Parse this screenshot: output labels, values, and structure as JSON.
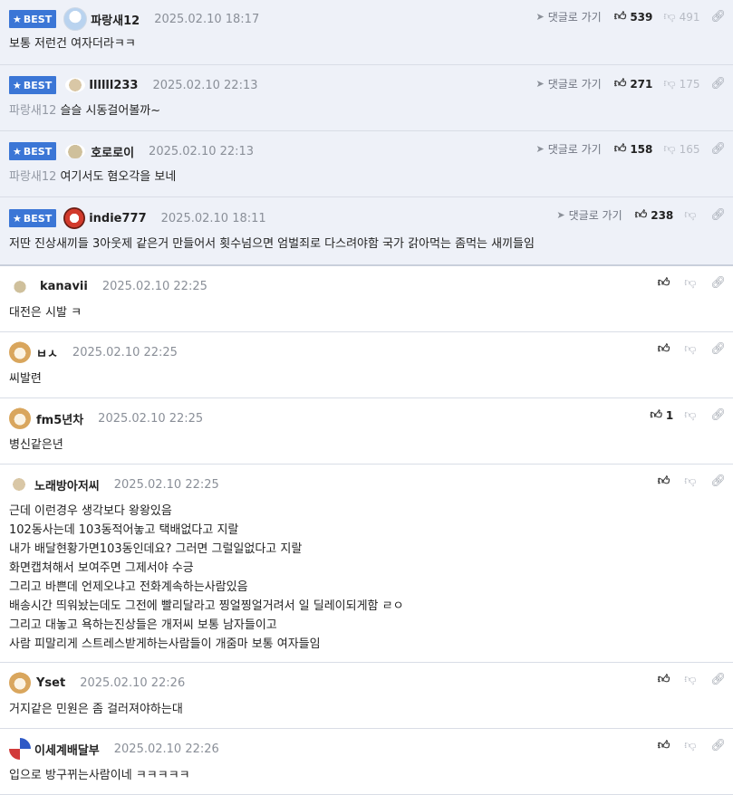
{
  "labels": {
    "best": "BEST",
    "reply_link": "댓글로 가기",
    "up_icon": "thumb-up-icon",
    "down_icon": "thumb-down-icon",
    "link_icon": "link-icon"
  },
  "best_comments": [
    {
      "nick": "파랑새12",
      "date": "2025.02.10 18:17",
      "up": "539",
      "down": "491",
      "quote": "",
      "text": "보통 저런건 여자더라ㅋㅋ"
    },
    {
      "nick": "Illlll233",
      "date": "2025.02.10 22:13",
      "up": "271",
      "down": "175",
      "quote": "파랑새12",
      "text": "슬슬 시동걸어볼까~"
    },
    {
      "nick": "호로로이",
      "date": "2025.02.10 22:13",
      "up": "158",
      "down": "165",
      "quote": "파랑새12",
      "text": "여기서도 혐오각을 보네"
    },
    {
      "nick": "indie777",
      "date": "2025.02.10 18:11",
      "up": "238",
      "down": "",
      "quote": "",
      "text": "저딴 진상새끼들 3아웃제 같은거 만들어서 횟수넘으면 엄벌죄로 다스려야함 국가 갉아먹는 좀먹는 새끼들임"
    }
  ],
  "comments": [
    {
      "nick": "kanavii",
      "date": "2025.02.10 22:25",
      "up": "",
      "lines": [
        "대전은 시발 ㅋ"
      ]
    },
    {
      "nick": "ㅂㅅ",
      "date": "2025.02.10 22:25",
      "up": "",
      "lines": [
        "씨발련"
      ]
    },
    {
      "nick": "fm5년차",
      "date": "2025.02.10 22:25",
      "up": "1",
      "lines": [
        "병신같은년"
      ]
    },
    {
      "nick": "노래방아저씨",
      "date": "2025.02.10 22:25",
      "up": "",
      "lines": [
        "근데 이런경우 생각보다 왕왕있음",
        "102동사는데 103동적어놓고 택배없다고 지랄",
        "내가 배달현황가면103동인데요? 그러면 그럴일없다고 지랄",
        "화면캡쳐해서 보여주면 그제서야 수긍",
        "그리고 바쁜데 언제오냐고 전화계속하는사람있음",
        "배송시간 띄워놨는데도 그전에 빨리달라고 찡얼찡얼거려서 일 딜레이되게함 ㄹㅇ",
        "그리고 대놓고 욕하는진상들은 개저씨 보통 남자들이고",
        "사람 피말리게 스트레스받게하는사람들이 개줌마 보통 여자들임"
      ]
    },
    {
      "nick": "Yset",
      "date": "2025.02.10 22:26",
      "up": "",
      "lines": [
        "거지같은 민원은 좀 걸러져야하는대"
      ]
    },
    {
      "nick": "이세계배달부",
      "date": "2025.02.10 22:26",
      "up": "",
      "lines": [
        "입으로 방구뀌는사람이네 ㅋㅋㅋㅋㅋ"
      ]
    }
  ]
}
